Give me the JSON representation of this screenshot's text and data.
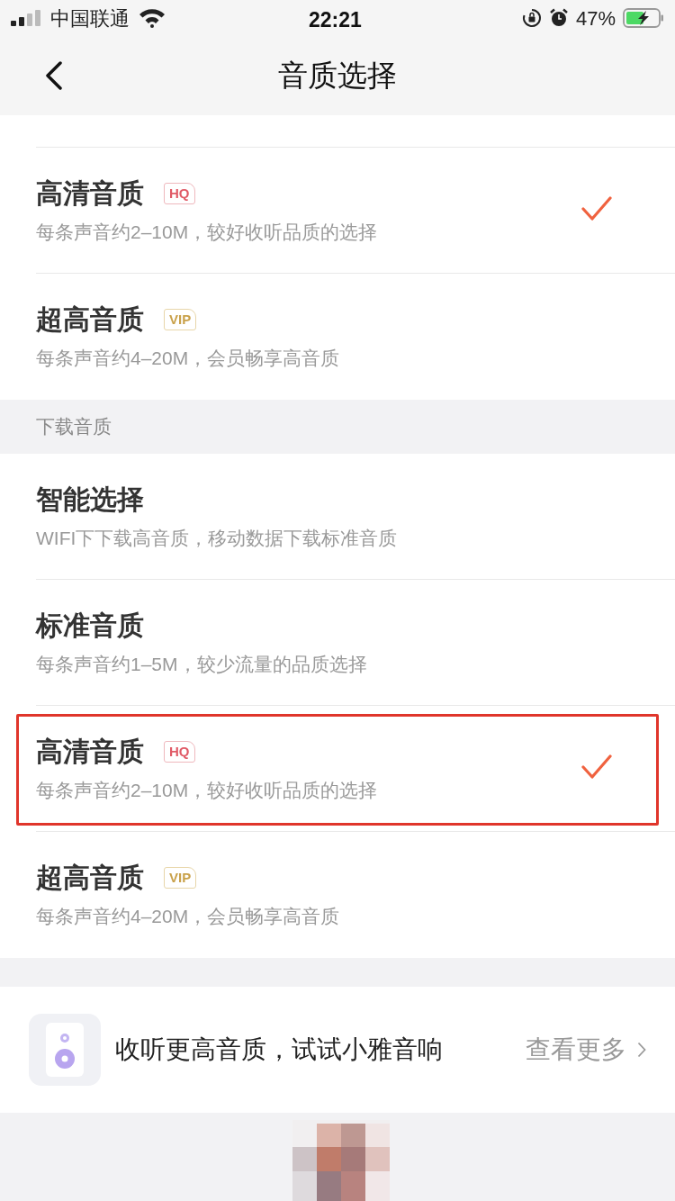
{
  "status_bar": {
    "carrier": "中国联通",
    "time": "22:21",
    "battery": "47%"
  },
  "nav": {
    "title": "音质选择"
  },
  "play_options": [
    {
      "title": "高清音质",
      "badge": {
        "kind": "hq",
        "text": "HQ"
      },
      "description": "每条声音约2–10M，较好收听品质的选择",
      "selected": true
    },
    {
      "title": "超高音质",
      "badge": {
        "kind": "vip",
        "text": "VIP"
      },
      "description": "每条声音约4–20M，会员畅享高音质",
      "selected": false
    }
  ],
  "download_section": {
    "header": "下载音质",
    "options": [
      {
        "title": "智能选择",
        "description": "WIFI下下载高音质，移动数据下载标准音质",
        "selected": false,
        "annotated": false
      },
      {
        "title": "标准音质",
        "description": "每条声音约1–5M，较少流量的品质选择",
        "selected": false,
        "annotated": false
      },
      {
        "title": "高清音质",
        "badge": {
          "kind": "hq",
          "text": "HQ"
        },
        "description": "每条声音约2–10M，较好收听品质的选择",
        "selected": true,
        "annotated": true
      },
      {
        "title": "超高音质",
        "badge": {
          "kind": "vip",
          "text": "VIP"
        },
        "description": "每条声音约4–20M，会员畅享高音质",
        "selected": false,
        "annotated": false
      }
    ]
  },
  "promo": {
    "text": "收听更高音质，试试小雅音响",
    "link": "查看更多"
  }
}
